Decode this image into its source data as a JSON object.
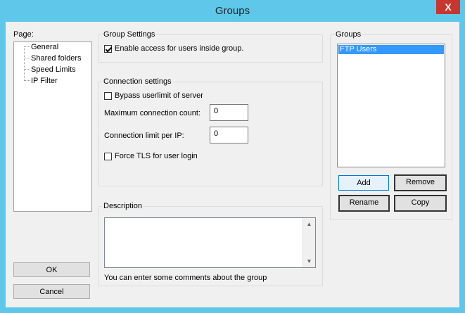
{
  "window": {
    "title": "Groups",
    "close_glyph": "X"
  },
  "page_panel": {
    "label": "Page:",
    "items": [
      "General",
      "Shared folders",
      "Speed Limits",
      "IP Filter"
    ]
  },
  "group_settings": {
    "title": "Group Settings",
    "enable_access": {
      "label": "Enable access for users inside group.",
      "checked": true
    }
  },
  "connection_settings": {
    "title": "Connection settings",
    "bypass": {
      "label": "Bypass userlimit of server",
      "checked": false
    },
    "max_conn": {
      "label": "Maximum connection count:",
      "value": "0"
    },
    "limit_per_ip": {
      "label": "Connection limit per IP:",
      "value": "0"
    },
    "force_tls": {
      "label": "Force TLS for user login",
      "checked": false
    }
  },
  "description": {
    "title": "Description",
    "value": "",
    "hint": "You can enter some comments about the group"
  },
  "groups": {
    "title": "Groups",
    "items": [
      {
        "label": "FTP Users",
        "selected": true
      }
    ],
    "buttons": {
      "add": "Add",
      "remove": "Remove",
      "rename": "Rename",
      "copy": "Copy"
    }
  },
  "footer": {
    "ok": "OK",
    "cancel": "Cancel"
  },
  "icons": {
    "scroll_up": "scroll-up-arrow-icon",
    "scroll_down": "scroll-down-arrow-icon",
    "close": "close-icon"
  },
  "colors": {
    "titlebar": "#5fc8ea",
    "close": "#c7372f",
    "selection": "#3399ff"
  }
}
